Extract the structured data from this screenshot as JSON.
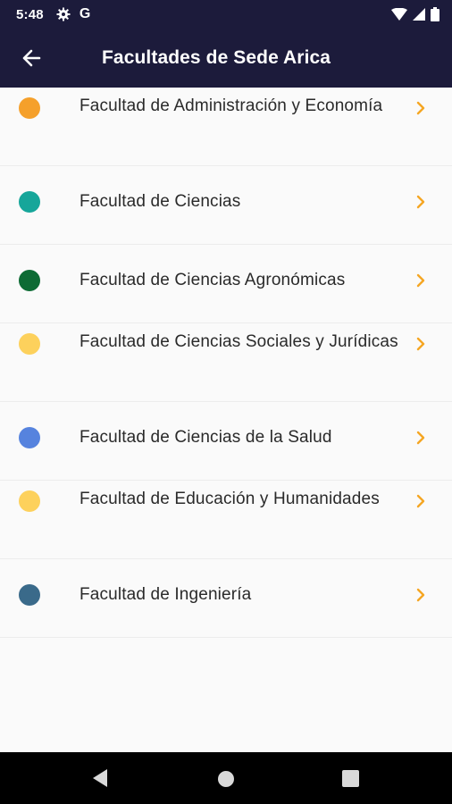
{
  "status_bar": {
    "time": "5:48",
    "g_label": "G",
    "icons": [
      "gear-icon",
      "google-icon",
      "wifi-icon",
      "signal-icon",
      "battery-icon"
    ]
  },
  "app_bar": {
    "title": "Facultades de Sede Arica",
    "back_icon": "arrow-left-icon"
  },
  "accent_color": "#f5a623",
  "faculties": [
    {
      "label": "Facultad de Administración y Economía",
      "color": "#f5a02b"
    },
    {
      "label": "Facultad de Ciencias",
      "color": "#16a69a"
    },
    {
      "label": "Facultad de Ciencias Agronómicas",
      "color": "#0d6b34"
    },
    {
      "label": "Facultad de Ciencias Sociales y Jurídicas",
      "color": "#fdd15c"
    },
    {
      "label": "Facultad de Ciencias de la Salud",
      "color": "#5683de"
    },
    {
      "label": "Facultad de Educación y Humanidades",
      "color": "#fdd15c"
    },
    {
      "label": "Facultad de Ingeniería",
      "color": "#3a6a8a"
    }
  ],
  "nav_bar": {
    "icons": [
      "back-triangle-icon",
      "home-circle-icon",
      "recents-square-icon"
    ]
  }
}
